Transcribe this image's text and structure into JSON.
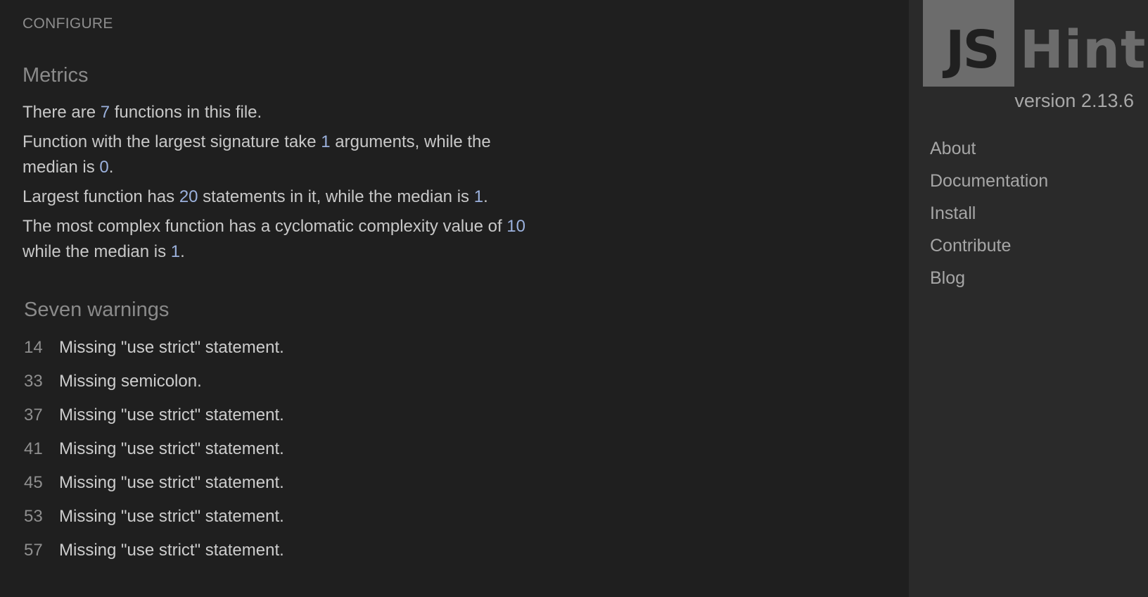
{
  "header": {
    "configure_label": "CONFIGURE"
  },
  "metrics": {
    "title": "Metrics",
    "line1": {
      "pre": "There are ",
      "functions": "7",
      "post": " functions in this file."
    },
    "line2": {
      "pre": "Function with the largest signature take ",
      "largest_args": "1",
      "mid": " arguments, while the median is ",
      "median_args": "0",
      "post": "."
    },
    "line3": {
      "pre": "Largest function has ",
      "largest_statements": "20",
      "mid": " statements in it, while the median is ",
      "median_statements": "1",
      "post": "."
    },
    "line4": {
      "pre": "The most complex function has a cyclomatic complexity value of ",
      "max_complexity": "10",
      "mid": " while the median is ",
      "median_complexity": "1",
      "post": "."
    }
  },
  "warnings": {
    "title": "Seven warnings",
    "items": [
      {
        "line": "14",
        "message": "Missing \"use strict\" statement."
      },
      {
        "line": "33",
        "message": "Missing semicolon."
      },
      {
        "line": "37",
        "message": "Missing \"use strict\" statement."
      },
      {
        "line": "41",
        "message": "Missing \"use strict\" statement."
      },
      {
        "line": "45",
        "message": "Missing \"use strict\" statement."
      },
      {
        "line": "53",
        "message": "Missing \"use strict\" statement."
      },
      {
        "line": "57",
        "message": "Missing \"use strict\" statement."
      }
    ]
  },
  "sidebar": {
    "logo": {
      "part1": "JS",
      "part2": "Hint"
    },
    "version": "version 2.13.6",
    "nav": [
      {
        "label": "About"
      },
      {
        "label": "Documentation"
      },
      {
        "label": "Install"
      },
      {
        "label": "Contribute"
      },
      {
        "label": "Blog"
      }
    ]
  },
  "colors": {
    "background": "#1f1f1f",
    "sidebar_background": "#2a2a2a",
    "number_accent": "#9bb1dd",
    "logo_gray": "#6c6c6c"
  }
}
